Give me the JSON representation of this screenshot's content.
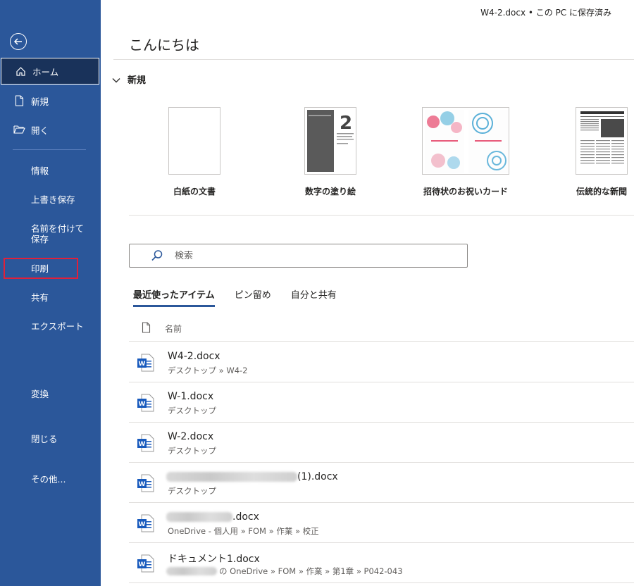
{
  "header": {
    "doc_status": "W4-2.docx • この PC に保存済み"
  },
  "sidebar": {
    "items": [
      {
        "label": "ホーム"
      },
      {
        "label": "新規"
      },
      {
        "label": "開く"
      },
      {
        "label": "情報"
      },
      {
        "label": "上書き保存"
      },
      {
        "label": "名前を付けて保存"
      },
      {
        "label": "印刷"
      },
      {
        "label": "共有"
      },
      {
        "label": "エクスポート"
      },
      {
        "label": "変換"
      },
      {
        "label": "閉じる"
      },
      {
        "label": "その他..."
      }
    ]
  },
  "main": {
    "greeting": "こんにちは",
    "new_section_title": "新規",
    "templates": [
      {
        "label": "白紙の文書"
      },
      {
        "label": "数字の塗り絵"
      },
      {
        "label": "招待状のお祝いカード"
      },
      {
        "label": "伝統的な新聞"
      }
    ],
    "search": {
      "placeholder": "検索"
    },
    "tabs": [
      {
        "label": "最近使ったアイテム"
      },
      {
        "label": "ピン留め"
      },
      {
        "label": "自分と共有"
      }
    ],
    "list_header": {
      "name": "名前"
    },
    "files": [
      {
        "name": "W4-2.docx",
        "path": "デスクトップ » W4-2"
      },
      {
        "name": "W-1.docx",
        "path": "デスクトップ"
      },
      {
        "name": "W-2.docx",
        "path": "デスクトップ"
      },
      {
        "name": "(1).docx",
        "path": "デスクトップ"
      },
      {
        "name": ".docx",
        "path": "OneDrive - 個人用 » FOM » 作業 » 校正"
      },
      {
        "name": "ドキュメント1.docx",
        "path": "の OneDrive » FOM » 作業 » 第1章 » P042-043"
      }
    ]
  },
  "colors": {
    "sidebar": "#2b579a",
    "accent": "#2b579a",
    "highlight": "#e0203a",
    "word_blue": "#185abd"
  }
}
